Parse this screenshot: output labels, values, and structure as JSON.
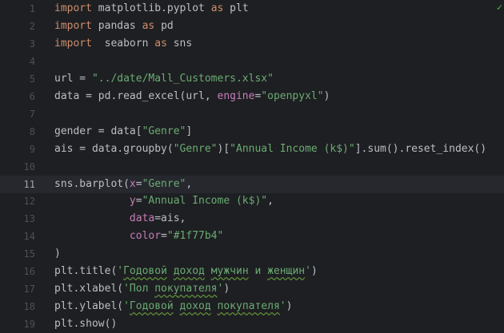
{
  "editor": {
    "lines": [
      {
        "n": "1",
        "t": [
          {
            "c": "kw",
            "s": "import"
          },
          {
            "s": " matplotlib.pyplot "
          },
          {
            "c": "kw",
            "s": "as"
          },
          {
            "s": " plt"
          }
        ]
      },
      {
        "n": "2",
        "t": [
          {
            "c": "kw",
            "s": "import"
          },
          {
            "s": " pandas "
          },
          {
            "c": "kw",
            "s": "as"
          },
          {
            "s": " pd"
          }
        ]
      },
      {
        "n": "3",
        "t": [
          {
            "c": "kw",
            "s": "import"
          },
          {
            "s": "  seaborn "
          },
          {
            "c": "kw",
            "s": "as"
          },
          {
            "s": " sns"
          }
        ]
      },
      {
        "n": "4",
        "t": []
      },
      {
        "n": "5",
        "t": [
          {
            "s": "url = "
          },
          {
            "c": "str",
            "s": "\"../date/Mall_Customers.xlsx\""
          }
        ]
      },
      {
        "n": "6",
        "t": [
          {
            "s": "data = pd.read_excel(url, "
          },
          {
            "c": "par",
            "s": "engine"
          },
          {
            "s": "="
          },
          {
            "c": "str",
            "s": "\"openpyxl\""
          },
          {
            "s": ")"
          }
        ]
      },
      {
        "n": "7",
        "t": []
      },
      {
        "n": "8",
        "t": [
          {
            "s": "gender = data["
          },
          {
            "c": "str",
            "s": "\"Genre\""
          },
          {
            "s": "]"
          }
        ]
      },
      {
        "n": "9",
        "t": [
          {
            "s": "ais = data.groupby("
          },
          {
            "c": "str",
            "s": "\"Genre\""
          },
          {
            "s": ")["
          },
          {
            "c": "str",
            "s": "\"Annual Income (k$)\""
          },
          {
            "s": "].sum().reset_index()"
          }
        ]
      },
      {
        "n": "10",
        "t": []
      },
      {
        "n": "11",
        "t": [
          {
            "s": "sns.barplot("
          },
          {
            "c": "par",
            "s": "x"
          },
          {
            "s": "="
          },
          {
            "c": "str",
            "s": "\"Genre\""
          },
          {
            "s": ","
          }
        ]
      },
      {
        "n": "12",
        "t": [
          {
            "s": "            "
          },
          {
            "c": "par",
            "s": "y"
          },
          {
            "s": "="
          },
          {
            "c": "str",
            "s": "\"Annual Income (k$)\""
          },
          {
            "s": ","
          }
        ]
      },
      {
        "n": "13",
        "t": [
          {
            "s": "            "
          },
          {
            "c": "par",
            "s": "data"
          },
          {
            "s": "=ais,"
          }
        ]
      },
      {
        "n": "14",
        "t": [
          {
            "s": "            "
          },
          {
            "c": "par",
            "s": "color"
          },
          {
            "s": "="
          },
          {
            "c": "str",
            "s": "\"#1f77b4\""
          }
        ]
      },
      {
        "n": "15",
        "t": [
          {
            "s": ")"
          }
        ]
      },
      {
        "n": "16",
        "t": [
          {
            "s": "plt.title("
          },
          {
            "c": "str",
            "s": "'Годовой доход мужчин и женщин'"
          },
          {
            "s": ")"
          }
        ]
      },
      {
        "n": "17",
        "t": [
          {
            "s": "plt.xlabel("
          },
          {
            "c": "str",
            "s": "'Пол покупателя'"
          },
          {
            "s": ")"
          }
        ]
      },
      {
        "n": "18",
        "t": [
          {
            "s": "plt.ylabel("
          },
          {
            "c": "str",
            "s": "'Годовой доход покупателя'"
          },
          {
            "s": ")"
          }
        ]
      },
      {
        "n": "19",
        "t": [
          {
            "s": "plt.show()"
          }
        ]
      }
    ],
    "current_line": "11",
    "status_icon": "check-icon",
    "check_glyph": "✓",
    "typo_words": [
      "Годовой",
      "доход",
      "мужчин",
      "женщин",
      "покупателя"
    ]
  }
}
